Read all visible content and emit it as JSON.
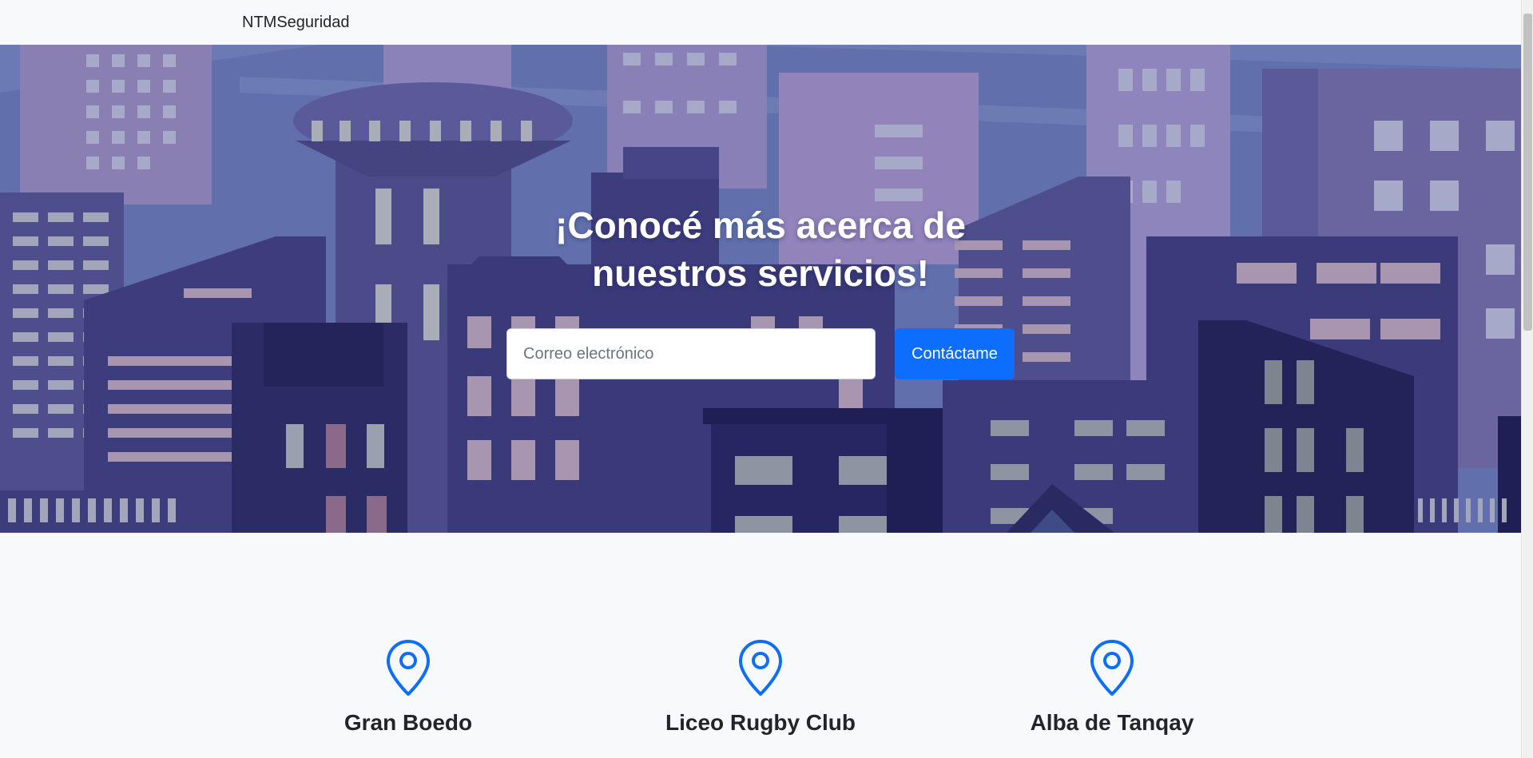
{
  "navbar": {
    "brand": "NTMSeguridad"
  },
  "hero": {
    "title_line1": "¡Conocé más acerca de",
    "title_line2": "nuestros servicios!",
    "email_placeholder": "Correo electrónico",
    "button_label": "Contáctame"
  },
  "features": [
    {
      "icon": "map-pin-icon",
      "title": "Gran Boedo"
    },
    {
      "icon": "map-pin-icon",
      "title": "Liceo Rugby Club"
    },
    {
      "icon": "map-pin-icon",
      "title": "Alba de Tanqay"
    }
  ],
  "colors": {
    "primary": "#0d6efd",
    "background": "#f8f9fa",
    "hero_base": "#5d6aa8"
  }
}
